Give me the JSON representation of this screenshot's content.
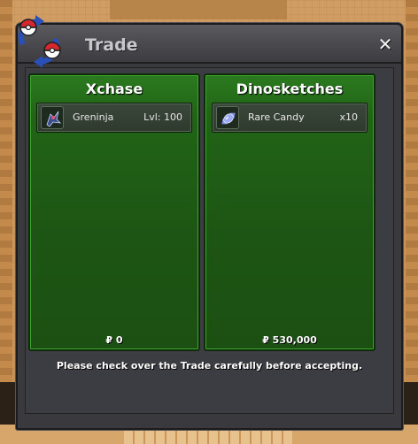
{
  "window": {
    "title": "Trade",
    "close_icon": "close-icon",
    "logo_icon": "trade-pokeballs-icon"
  },
  "offers": [
    {
      "player": "Xchase",
      "items": [
        {
          "icon": "greninja-icon",
          "name": "Greninja",
          "extra": "Lvl: 100"
        }
      ],
      "money": "₽ 0"
    },
    {
      "player": "Dinosketches",
      "items": [
        {
          "icon": "rare-candy-icon",
          "name": "Rare Candy",
          "extra": "x10"
        }
      ],
      "money": "₽ 530,000"
    }
  ],
  "notice": "Please check over the Trade carefully before accepting.",
  "colors": {
    "panel_green": "#216416",
    "window_gray": "#3a3a3e",
    "title_text": "#c8c8cc"
  }
}
